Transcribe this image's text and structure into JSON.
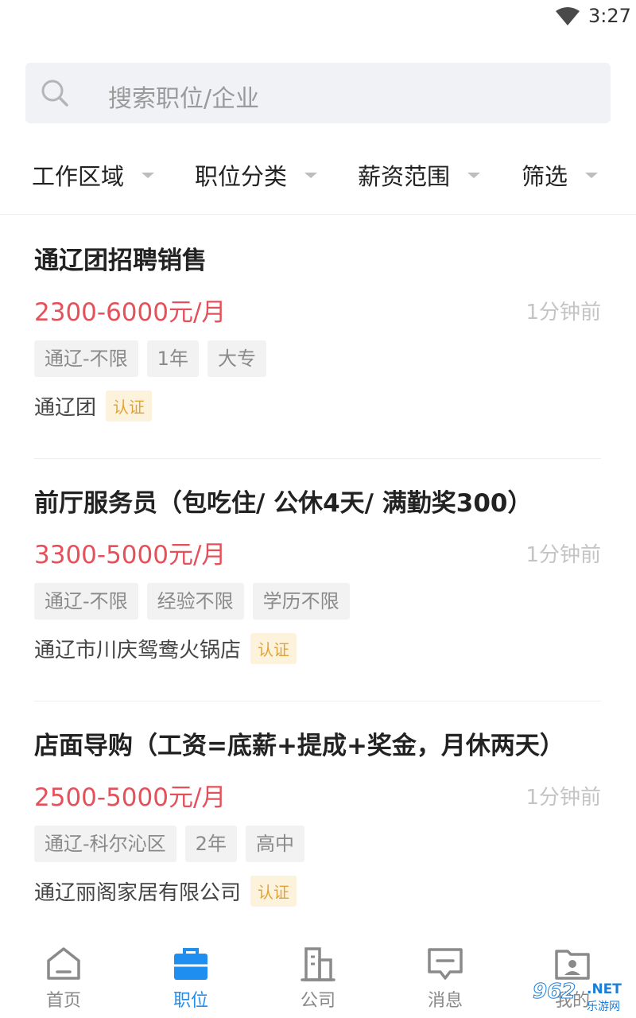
{
  "status_bar": {
    "time": "3:27",
    "wifi_icon": "wifi-icon"
  },
  "search": {
    "placeholder": "搜索职位/企业",
    "icon": "search-icon"
  },
  "filters": [
    {
      "label": "工作区域"
    },
    {
      "label": "职位分类"
    },
    {
      "label": "薪资范围"
    },
    {
      "label": "筛选"
    }
  ],
  "jobs": [
    {
      "title": "通辽团招聘销售",
      "salary": "2300-6000元/月",
      "time": "1分钟前",
      "tags": [
        "通辽-不限",
        "1年",
        "大专"
      ],
      "company": "通辽团",
      "verified": "认证"
    },
    {
      "title": "前厅服务员（包吃住/ 公休4天/  满勤奖300）",
      "salary": "3300-5000元/月",
      "time": "1分钟前",
      "tags": [
        "通辽-不限",
        "经验不限",
        "学历不限"
      ],
      "company": "通辽市川庆鸳鸯火锅店",
      "verified": "认证"
    },
    {
      "title": "店面导购（工资=底薪+提成+奖金，月休两天）",
      "salary": "2500-5000元/月",
      "time": "1分钟前",
      "tags": [
        "通辽-科尔沁区",
        "2年",
        "高中"
      ],
      "company": "通辽丽阁家居有限公司",
      "verified": "认证"
    }
  ],
  "tabs": [
    {
      "label": "首页",
      "icon": "home-icon"
    },
    {
      "label": "职位",
      "icon": "briefcase-icon",
      "active": true
    },
    {
      "label": "公司",
      "icon": "building-icon"
    },
    {
      "label": "消息",
      "icon": "message-icon"
    },
    {
      "label": "我的",
      "icon": "profile-icon"
    }
  ],
  "watermark": {
    "brand": "962",
    "net": ".NET",
    "sub": "乐游网"
  },
  "colors": {
    "accent": "#1f8ef1",
    "salary": "#e5505a",
    "verified_bg": "#fdf3dd",
    "verified_text": "#e0a33a"
  }
}
